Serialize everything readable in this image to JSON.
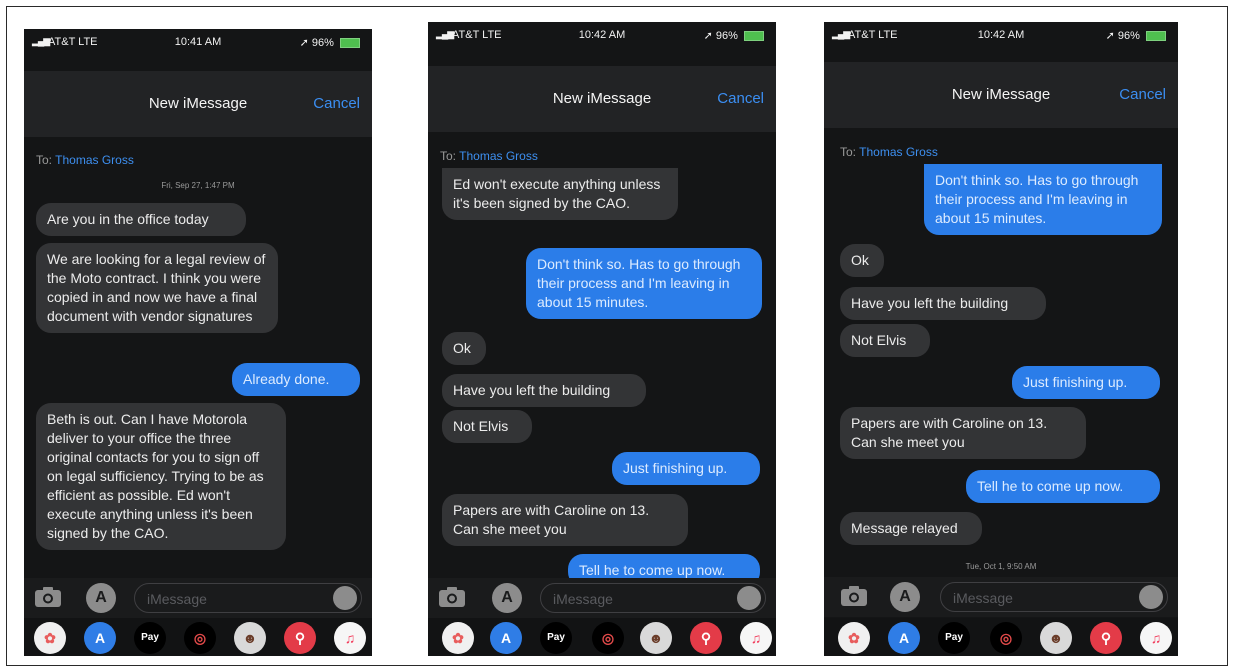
{
  "phones": [
    {
      "status": {
        "carrier": "AT&T LTE",
        "time": "10:41 AM",
        "battery": "96%"
      },
      "header": {
        "title": "New iMessage",
        "cancel": "Cancel"
      },
      "to": {
        "label": "To:",
        "recipient": "Thomas Gross"
      },
      "timestamp": "Fri, Sep 27, 1:47 PM",
      "messages": [
        {
          "dir": "in",
          "text": "Are you in the office today"
        },
        {
          "dir": "in",
          "text": "We are looking for a legal review of the Moto contract. I think you were copied  in and now we have a final document with vendor signatures"
        },
        {
          "dir": "out",
          "text": "Already done."
        },
        {
          "dir": "in",
          "text": "Beth is out. Can I have Motorola deliver to your office the three original contacts for you to sign off on legal sufficiency.  Trying to be as efficient as possible. Ed won't execute anything unless it's been signed by the CAO."
        }
      ],
      "input_placeholder": "iMessage"
    },
    {
      "status": {
        "carrier": "AT&T LTE",
        "time": "10:42 AM",
        "battery": "96%"
      },
      "header": {
        "title": "New iMessage",
        "cancel": "Cancel"
      },
      "to": {
        "label": "To:",
        "recipient": "Thomas Gross"
      },
      "messages": [
        {
          "dir": "in",
          "text": "Ed won't execute anything unless it's been signed by the CAO."
        },
        {
          "dir": "out",
          "text": "Don't think so. Has to go through their process and I'm leaving in about 15 minutes."
        },
        {
          "dir": "in",
          "text": "Ok"
        },
        {
          "dir": "in",
          "text": "Have you left the building"
        },
        {
          "dir": "in",
          "text": "Not Elvis"
        },
        {
          "dir": "out",
          "text": "Just finishing up."
        },
        {
          "dir": "in",
          "text": "Papers are with Caroline on 13. Can she meet you"
        },
        {
          "dir": "out",
          "text": "Tell he to come up now."
        }
      ],
      "input_placeholder": "iMessage"
    },
    {
      "status": {
        "carrier": "AT&T LTE",
        "time": "10:42 AM",
        "battery": "96%"
      },
      "header": {
        "title": "New iMessage",
        "cancel": "Cancel"
      },
      "to": {
        "label": "To:",
        "recipient": "Thomas Gross"
      },
      "timestamp": "Tue, Oct 1, 9:50 AM",
      "messages": [
        {
          "dir": "out",
          "text": "Don't think so. Has to go through their process and I'm leaving in about 15 minutes."
        },
        {
          "dir": "in",
          "text": "Ok"
        },
        {
          "dir": "in",
          "text": "Have you left the building"
        },
        {
          "dir": "in",
          "text": "Not Elvis"
        },
        {
          "dir": "out",
          "text": "Just finishing up."
        },
        {
          "dir": "in",
          "text": "Papers are with Caroline on 13. Can she meet you"
        },
        {
          "dir": "out",
          "text": "Tell he to come up now."
        },
        {
          "dir": "in",
          "text": "Message relayed"
        }
      ],
      "input_placeholder": "iMessage"
    }
  ],
  "dock": {
    "apple_pay_label": "Pay"
  }
}
